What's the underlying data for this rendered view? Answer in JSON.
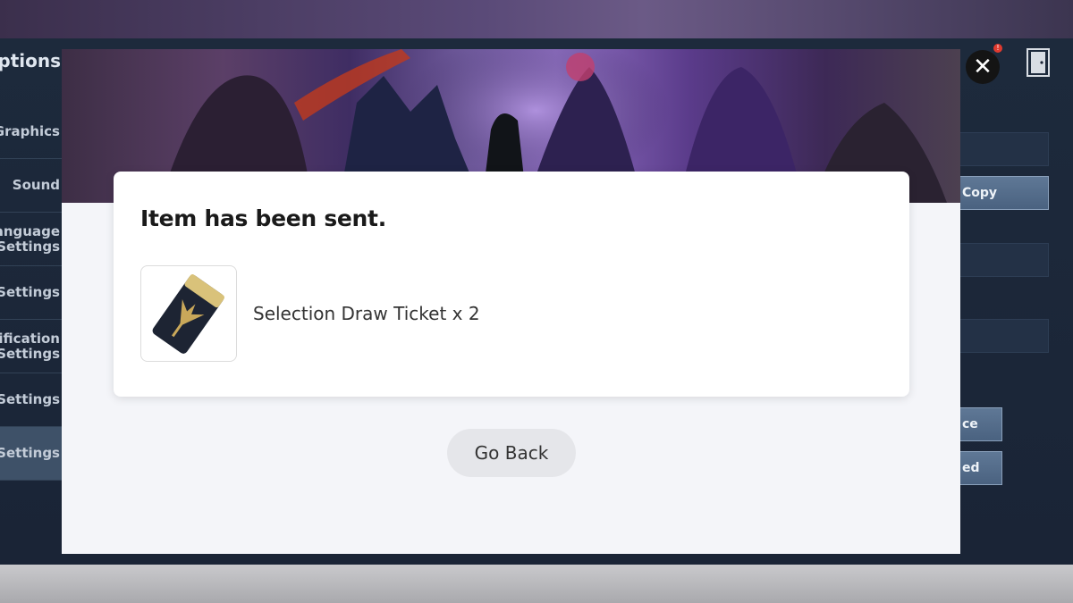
{
  "background": {
    "options_title": "Options",
    "menu_items": [
      {
        "label": "Graphics"
      },
      {
        "label": "Sound"
      },
      {
        "label": "Language\nSettings"
      },
      {
        "label": "Control Settings"
      },
      {
        "label": "Notification\nSettings"
      },
      {
        "label": "Game Settings"
      },
      {
        "label": "Account Settings"
      }
    ],
    "right_buttons": {
      "copy": "Copy",
      "ce": "ce",
      "ed": "ed"
    },
    "notification_badge": "!"
  },
  "modal": {
    "title": "Item has been sent.",
    "item": {
      "name": "Selection Draw Ticket x 2",
      "icon": "ticket-icon"
    },
    "go_back_label": "Go Back"
  },
  "colors": {
    "modal_bg": "#f4f5f9",
    "card_bg": "#ffffff",
    "button_bg": "#e5e6ea",
    "accent_purple": "#6f5a9c"
  }
}
